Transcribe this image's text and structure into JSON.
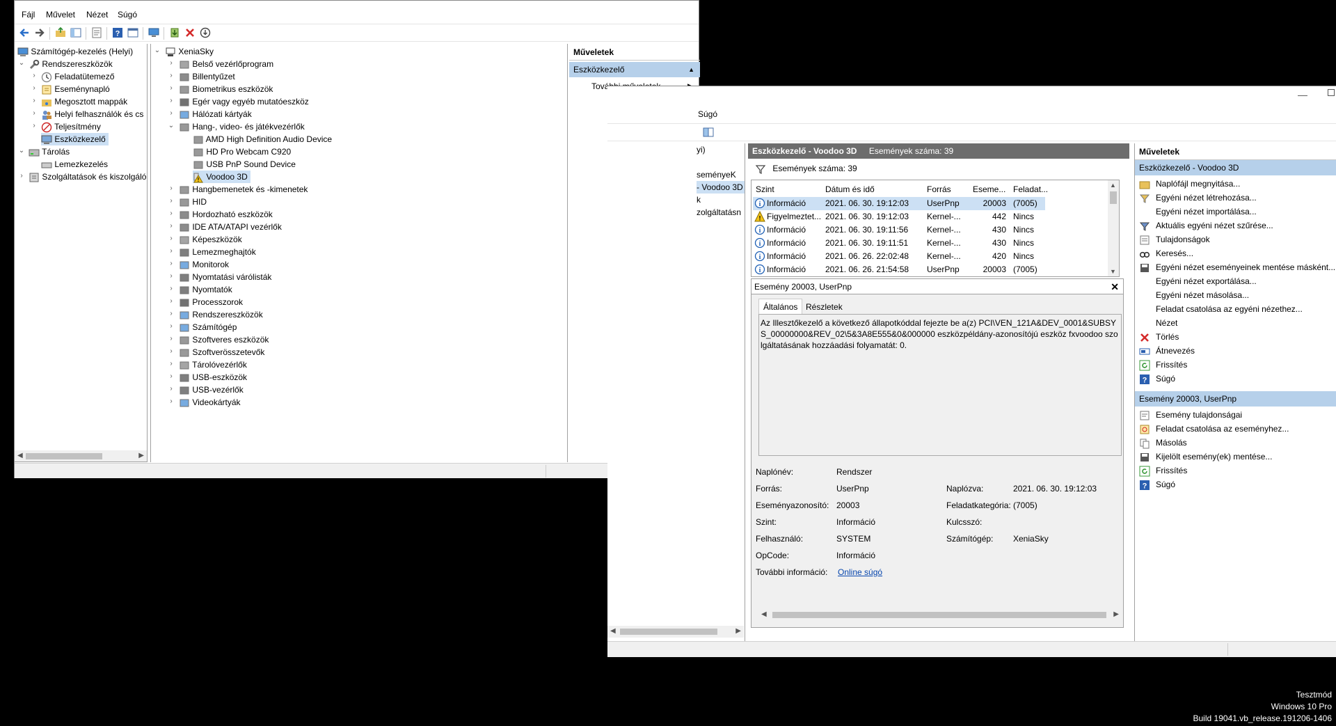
{
  "compmgmt": {
    "menu": [
      "Fájl",
      "Művelet",
      "Nézet",
      "Súgó"
    ],
    "tree": [
      {
        "label": "Számítógép-kezelés (Helyi)",
        "icon": "computer-management-icon"
      },
      {
        "label": "Rendszereszközök",
        "icon": "tools-icon"
      },
      {
        "label": "Feladatütemező",
        "icon": "clock-icon"
      },
      {
        "label": "Eseménynapló",
        "icon": "event-log-icon"
      },
      {
        "label": "Megosztott mappák",
        "icon": "shared-folder-icon"
      },
      {
        "label": "Helyi felhasználók és cs",
        "icon": "users-icon"
      },
      {
        "label": "Teljesítmény",
        "icon": "performance-icon"
      },
      {
        "label": "Eszközkezelő",
        "icon": "device-manager-icon"
      },
      {
        "label": "Tárolás",
        "icon": "storage-icon"
      },
      {
        "label": "Lemezkezelés",
        "icon": "disk-icon"
      },
      {
        "label": "Szolgáltatások és kiszolgáló",
        "icon": "services-icon"
      }
    ],
    "devices": {
      "root": "XeniaSky",
      "items": [
        "Belső vezérlőprogram",
        "Billentyűzet",
        "Biometrikus eszközök",
        "Egér vagy egyéb mutatóeszköz",
        "Hálózati kártyák",
        "Hang-, video- és játékvezérlők",
        "AMD High Definition Audio Device",
        "HD Pro Webcam C920",
        "USB PnP Sound Device",
        "Voodoo 3D",
        "Hangbemenetek és -kimenetek",
        "HID",
        "Hordozható eszközök",
        "IDE ATA/ATAPI vezérlők",
        "Képeszközök",
        "Lemezmeghajtók",
        "Monitorok",
        "Nyomtatási várólisták",
        "Nyomtatók",
        "Processzorok",
        "Rendszereszközök",
        "Számítógép",
        "Szoftveres eszközök",
        "Szoftverösszetevők",
        "Tárolóvezérlők",
        "USB-eszközök",
        "USB-vezérlők",
        "Videokártyák"
      ]
    },
    "actions": {
      "title": "Műveletek",
      "section": "Eszközkezelő",
      "more": "További műveletek"
    }
  },
  "eventviewer": {
    "menu_fragment": "Súgó",
    "left_fragments": [
      "yi)",
      "seményeK",
      "- Voodoo 3D",
      "k",
      "zolgáltatásn"
    ],
    "header": {
      "title": "Eszközkezelő - Voodoo 3D",
      "count": "Események száma: 39"
    },
    "filter_text": "Események száma: 39",
    "columns": [
      "Szint",
      "Dátum és idő",
      "Forrás",
      "Eseme...",
      "Feladat..."
    ],
    "rows": [
      {
        "level": "Információ",
        "date": "2021. 06. 30. 19:12:03",
        "source": "UserPnp",
        "id": "20003",
        "task": "(7005)",
        "type": "info"
      },
      {
        "level": "Figyelmeztet...",
        "date": "2021. 06. 30. 19:12:03",
        "source": "Kernel-...",
        "id": "442",
        "task": "Nincs",
        "type": "warn"
      },
      {
        "level": "Információ",
        "date": "2021. 06. 30. 19:11:56",
        "source": "Kernel-...",
        "id": "430",
        "task": "Nincs",
        "type": "info"
      },
      {
        "level": "Információ",
        "date": "2021. 06. 30. 19:11:51",
        "source": "Kernel-...",
        "id": "430",
        "task": "Nincs",
        "type": "info"
      },
      {
        "level": "Információ",
        "date": "2021. 06. 26. 22:02:48",
        "source": "Kernel-...",
        "id": "420",
        "task": "Nincs",
        "type": "info"
      },
      {
        "level": "Információ",
        "date": "2021. 06. 26. 21:54:58",
        "source": "UserPnp",
        "id": "20003",
        "task": "(7005)",
        "type": "info"
      }
    ],
    "detail": {
      "title": "Esemény 20003, UserPnp",
      "tabs": [
        "Általános",
        "Részletek"
      ],
      "message": "Az Illesztőkezelő a következő állapotkóddal fejezte be a(z) PCI\\VEN_121A&DEV_0001&SUBSYS_00000000&REV_02\\5&3A8E555&0&000000 eszközpéldány-azonosítójú eszköz fxvoodoo szolgáltatásának hozzáadási folyamatát: 0.",
      "fields": {
        "lognev_label": "Naplónév:",
        "lognev": "Rendszer",
        "forras_label": "Forrás:",
        "forras": "UserPnp",
        "naplozva_label": "Naplózva:",
        "naplozva": "2021. 06. 30. 19:12:03",
        "esemenyazon_label": "Eseményazonosító:",
        "esemenyazon": "20003",
        "feladatkat_label": "Feladatkategória:",
        "feladatkat": "(7005)",
        "szint_label": "Szint:",
        "szint": "Információ",
        "kulcsszo_label": "Kulcsszó:",
        "kulcsszo": "",
        "felhasznalo_label": "Felhasználó:",
        "felhasznalo": "SYSTEM",
        "szamitogep_label": "Számítógép:",
        "szamitogep": "XeniaSky",
        "opcode_label": "OpCode:",
        "opcode": "Információ",
        "tovabbi_label": "További információ:",
        "tovabbi": "Online súgó"
      }
    },
    "actions": {
      "title": "Műveletek",
      "section1": "Eszközkezelő - Voodoo 3D",
      "items1": [
        {
          "label": "Naplófájl megnyitása...",
          "icon": "open-folder-icon"
        },
        {
          "label": "Egyéni nézet létrehozása...",
          "icon": "filter-create-icon"
        },
        {
          "label": "Egyéni nézet importálása...",
          "icon": ""
        },
        {
          "label": "Aktuális egyéni nézet szűrése...",
          "icon": "filter-icon"
        },
        {
          "label": "Tulajdonságok",
          "icon": "properties-icon"
        },
        {
          "label": "Keresés...",
          "icon": "find-icon"
        },
        {
          "label": "Egyéni nézet eseményeinek mentése másként...",
          "icon": "save-icon"
        },
        {
          "label": "Egyéni nézet exportálása...",
          "icon": ""
        },
        {
          "label": "Egyéni nézet másolása...",
          "icon": ""
        },
        {
          "label": "Feladat csatolása az egyéni nézethez...",
          "icon": ""
        },
        {
          "label": "Nézet",
          "icon": ""
        },
        {
          "label": "Törlés",
          "icon": "delete-icon"
        },
        {
          "label": "Átnevezés",
          "icon": "rename-icon"
        },
        {
          "label": "Frissítés",
          "icon": "refresh-icon"
        },
        {
          "label": "Súgó",
          "icon": "help-icon"
        }
      ],
      "section2": "Esemény 20003, UserPnp",
      "items2": [
        {
          "label": "Esemény tulajdonságai",
          "icon": "event-properties-icon"
        },
        {
          "label": "Feladat csatolása az eseményhez...",
          "icon": "attach-task-icon"
        },
        {
          "label": "Másolás",
          "icon": "copy-icon"
        },
        {
          "label": "Kijelölt esemény(ek) mentése...",
          "icon": "save-icon"
        },
        {
          "label": "Frissítés",
          "icon": "refresh-icon"
        },
        {
          "label": "Súgó",
          "icon": "help-icon"
        }
      ]
    }
  },
  "watermark": {
    "line1": "Tesztmód",
    "line2": "Windows 10 Pro",
    "line3": "Build 19041.vb_release.191206-1406"
  },
  "colors": {
    "selection": "#cce0f4",
    "section_bg": "#b6d0ea",
    "header_gray": "#6d6d6d",
    "link": "#0645ad",
    "delete_red": "#d42a2a",
    "warn_yellow": "#f3c318",
    "info_blue": "#1e5fb4"
  }
}
